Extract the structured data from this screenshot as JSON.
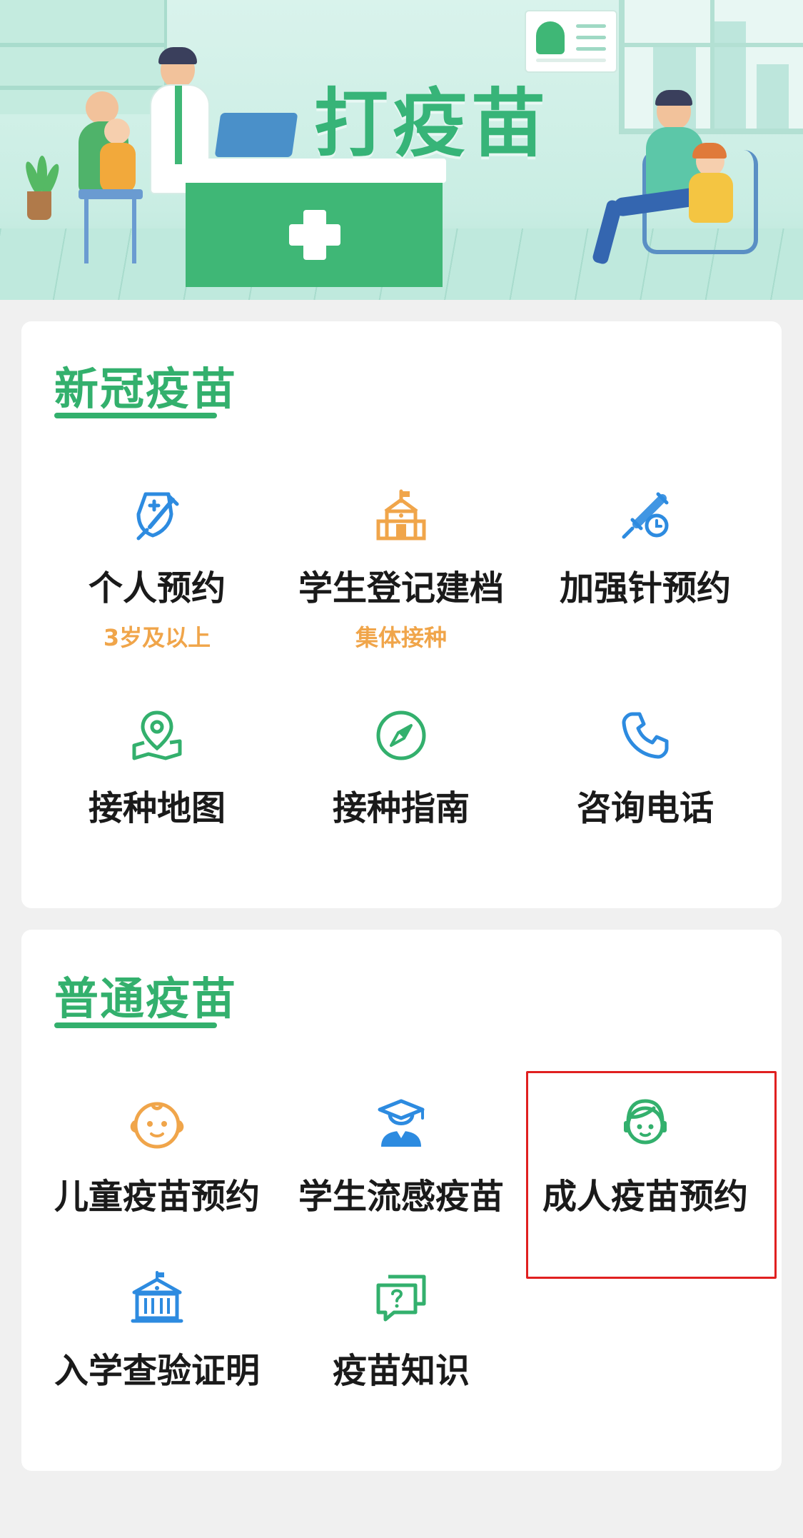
{
  "banner": {
    "title": "打疫苗"
  },
  "covid_section": {
    "title": "新冠疫苗",
    "items": [
      {
        "label": "个人预约",
        "sub": "3岁及以上",
        "icon": "shield-syringe-icon"
      },
      {
        "label": "学生登记建档",
        "sub": "集体接种",
        "icon": "school-icon"
      },
      {
        "label": "加强针预约",
        "sub": "",
        "icon": "syringe-clock-icon"
      },
      {
        "label": "接种地图",
        "sub": "",
        "icon": "map-pin-icon"
      },
      {
        "label": "接种指南",
        "sub": "",
        "icon": "compass-icon"
      },
      {
        "label": "咨询电话",
        "sub": "",
        "icon": "phone-icon"
      }
    ]
  },
  "regular_section": {
    "title": "普通疫苗",
    "items": [
      {
        "label": "儿童疫苗预约",
        "icon": "baby-face-icon"
      },
      {
        "label": "学生流感疫苗",
        "icon": "student-icon"
      },
      {
        "label": "成人疫苗预约",
        "icon": "adult-face-icon"
      },
      {
        "label": "入学查验证明",
        "icon": "school-building-icon"
      },
      {
        "label": "疫苗知识",
        "icon": "question-chat-icon"
      }
    ]
  },
  "colors": {
    "green": "#33b06d",
    "orange": "#f0a54a",
    "blue": "#2d8be0",
    "highlight": "#e02020"
  }
}
